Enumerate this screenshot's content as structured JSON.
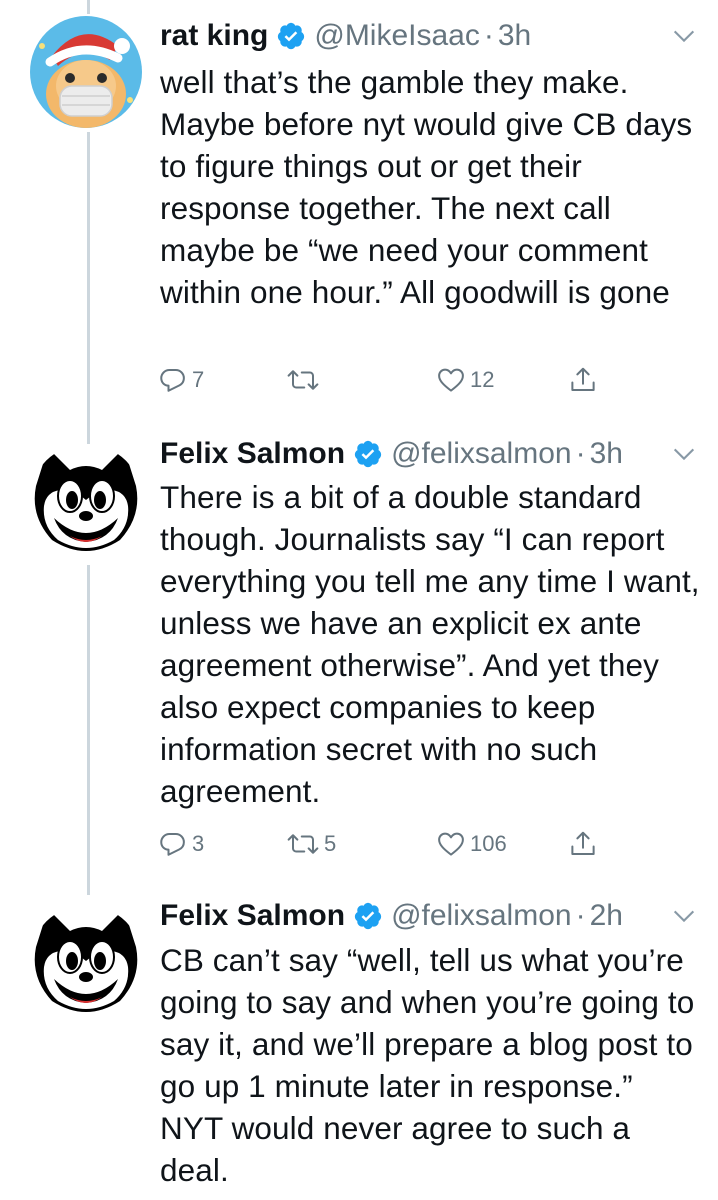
{
  "tweets": [
    {
      "display_name": "rat king",
      "handle": "@MikeIsaac",
      "separator": "·",
      "time": "3h",
      "text": "well that’s the gamble they make. Maybe before nyt would give CB days to figure things out or get their response together. The next call maybe be “we need your comment within one hour.”  All goodwill is gone",
      "reply_count": "7",
      "retweet_count": "",
      "like_count": "12",
      "verified": true
    },
    {
      "display_name": "Felix Salmon",
      "handle": "@felixsalmon",
      "separator": "·",
      "time": "3h",
      "text": "There is a bit of a double standard though. Journalists say “I can report everything you tell me any time I want, unless we have an explicit ex ante agreement otherwise”. And yet they also expect companies to keep information secret with no such agreement.",
      "reply_count": "3",
      "retweet_count": "5",
      "like_count": "106",
      "verified": true
    },
    {
      "display_name": "Felix Salmon",
      "handle": "@felixsalmon",
      "separator": "·",
      "time": "2h",
      "text": "CB can’t say “well, tell us what you’re going to say and when you’re going to say it, and we’ll prepare a blog post to go up 1 minute later in response.” NYT would never agree to such a deal.",
      "verified": true
    }
  ],
  "colors": {
    "verified": "#1da1f2",
    "secondary_text": "#66757f",
    "thread_line": "#ccd6dd"
  },
  "icons": {
    "reply": "reply-icon",
    "retweet": "retweet-icon",
    "like": "like-icon",
    "share": "share-icon",
    "verified": "verified-badge-icon",
    "caret": "chevron-down-icon"
  }
}
